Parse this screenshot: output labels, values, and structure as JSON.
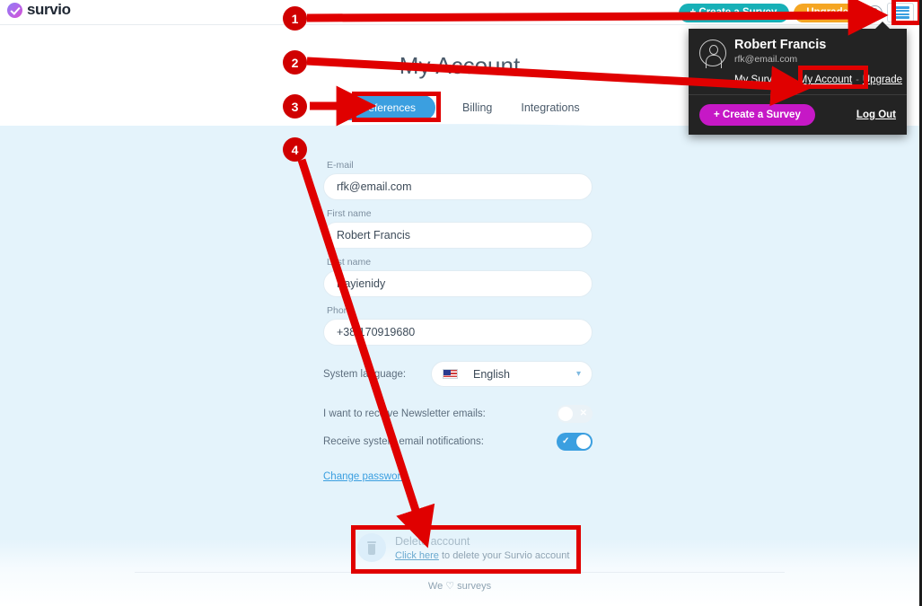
{
  "topbar": {
    "logo_text": "survio",
    "create_survey_label": "+ Create a Survey",
    "upgrade_label": "Upgrade",
    "help_label": "?"
  },
  "dropdown": {
    "user_name": "Robert Francis",
    "user_email": "rfk@email.com",
    "links": [
      {
        "label": "My Surveys"
      },
      {
        "label": "My Account"
      },
      {
        "label": "Upgrade"
      }
    ],
    "separator": "-",
    "create_survey_label": "+ Create a Survey",
    "logout_label": "Log Out"
  },
  "main": {
    "page_title": "My Account",
    "tabs": [
      {
        "label": "Preferences",
        "active": true
      },
      {
        "label": "Billing",
        "active": false
      },
      {
        "label": "Integrations",
        "active": false
      }
    ],
    "fields": [
      {
        "label": "E-mail",
        "value": "rfk@email.com"
      },
      {
        "label": "First name",
        "value": "Robert Francis"
      },
      {
        "label": "Last name",
        "value": "Kayienidy"
      },
      {
        "label": "Phone",
        "value": "+38 170919680"
      }
    ],
    "language": {
      "label": "System language:",
      "value": "English",
      "flag": "us-flag-icon",
      "chevron": "▾"
    },
    "toggles": [
      {
        "label": "I want to receive Newsletter emails:",
        "state": "off",
        "mark": "✕"
      },
      {
        "label": "Receive system email notifications:",
        "state": "on",
        "mark": "✓"
      }
    ],
    "change_password_label": "Change password"
  },
  "delete_account": {
    "title": "Delete account",
    "link_label": "Click here",
    "description": " to delete your Survio account",
    "icon": "trash-icon"
  },
  "footer": {
    "text_before": "We ",
    "heart": "♡",
    "text_after": " surveys"
  },
  "annotations": {
    "steps": [
      {
        "number": "1"
      },
      {
        "number": "2"
      },
      {
        "number": "3"
      },
      {
        "number": "4"
      }
    ],
    "accent_color": "#d00000"
  }
}
